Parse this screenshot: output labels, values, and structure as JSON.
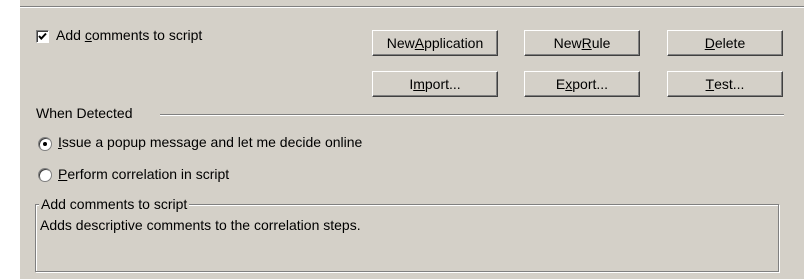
{
  "options": {
    "add_comments_checkbox": {
      "label_pre": "Add ",
      "label_mnemonic": "c",
      "label_post": "omments to script",
      "checked": true
    }
  },
  "buttons": {
    "new_application": {
      "pre": "New ",
      "mnemonic": "A",
      "post": "pplication"
    },
    "new_rule": {
      "pre": "New ",
      "mnemonic": "R",
      "post": "ule"
    },
    "delete": {
      "pre": "",
      "mnemonic": "D",
      "post": "elete"
    },
    "import": {
      "pre": "I",
      "mnemonic": "m",
      "post": "port..."
    },
    "export": {
      "pre": "E",
      "mnemonic": "x",
      "post": "port..."
    },
    "test": {
      "pre": "",
      "mnemonic": "T",
      "post": "est..."
    }
  },
  "when_detected": {
    "heading": "When Detected",
    "options": [
      {
        "pre": "",
        "mnemonic": "I",
        "post": "ssue a popup message and let me decide online",
        "selected": true
      },
      {
        "pre": "",
        "mnemonic": "P",
        "post": "erform correlation in script",
        "selected": false
      }
    ]
  },
  "description": {
    "title": "Add comments to script",
    "text": "Adds descriptive comments to the correlation steps."
  }
}
